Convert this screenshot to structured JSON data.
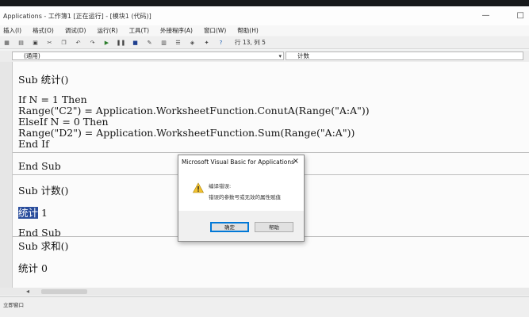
{
  "window": {
    "title": "Applications - 工作簿1 [正在运行] - [模块1 (代码)]",
    "minimize": "—",
    "maximize": "□"
  },
  "menu": [
    "插入(I)",
    "格式(O)",
    "调试(D)",
    "运行(R)",
    "工具(T)",
    "外接程序(A)",
    "窗口(W)",
    "帮助(H)"
  ],
  "toolbar": {
    "cursor_position": "行 13, 列 5"
  },
  "combos": {
    "object": "(通用)",
    "procedure": "计数"
  },
  "code_lines": {
    "l1": "Sub 统计()",
    "l2": "If N = 1 Then",
    "l3": "Range(\"C2\") = Application.WorksheetFunction.ConutA(Range(\"A:A\"))",
    "l4": "ElseIf N = 0 Then",
    "l5": "Range(\"D2\") = Application.WorksheetFunction.Sum(Range(\"A:A\"))",
    "l6": "End If",
    "l7": "End Sub",
    "l8": "Sub 计数()",
    "l9_selected": "统计",
    "l9_rest": " 1",
    "l10": "End Sub",
    "l11": "Sub 求和()",
    "l12": "统计 0"
  },
  "immediate": {
    "label": "立即窗口"
  },
  "dialog": {
    "title": "Microsoft Visual Basic for Applications",
    "close": "×",
    "heading": "编译错误:",
    "message": "错误的参数号或无效的属性赋值",
    "ok": "确定",
    "help": "帮助"
  }
}
